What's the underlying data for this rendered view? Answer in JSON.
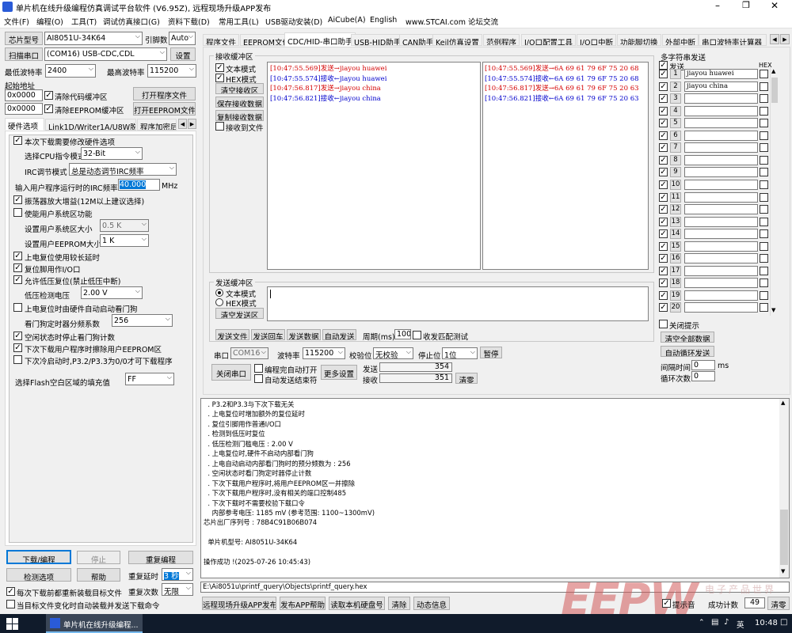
{
  "title": "单片机在线升级编程仿真调试平台软件 (V6.95Z), 远程现场升级APP发布",
  "menu": [
    "文件(F)",
    "编程(O)",
    "工具(T)",
    "调试仿真接口(G)",
    "资料下载(D)",
    "常用工具(L)",
    "USB驱动安装(D)",
    "AiCube(A)",
    "English",
    "www.STCAI.com 论坛交流"
  ],
  "left": {
    "chip_label": "芯片型号",
    "chip_value": "AI8051U-34K64",
    "pin_label": "引脚数",
    "pin_value": "Auto",
    "scan_label": "扫描串口",
    "port_value": "(COM16) USB-CDC,CDL",
    "settings_label": "设置",
    "min_baud_label": "最低波特率",
    "min_baud": "2400",
    "max_baud_label": "最高波特率",
    "max_baud": "115200",
    "start_addr_label": "起始地址",
    "addr1": "0x0000",
    "clear_code": "清除代码缓冲区",
    "open_prog": "打开程序文件",
    "addr2": "0x0000",
    "clear_eeprom": "清除EEPROM缓冲区",
    "open_eeprom": "打开EEPROM文件",
    "tabs": [
      "硬件选项",
      "Link1D/Writer1A/U8W脱机",
      "程序加密后"
    ],
    "hw_change": "本次下载需要修改硬件选项",
    "cpu_mode_label": "选择CPU指令模式",
    "cpu_mode": "32-Bit",
    "irc_mode_label": "IRC调节模式",
    "irc_mode": "总是动态调节IRC频率",
    "irc_freq_label": "输入用户程序运行时的IRC频率",
    "irc_freq": "40.000",
    "mhz": "MHz",
    "osc_gain": "振荡器放大增益(12M以上建议选择)",
    "user_sys": "使能用户系统区功能",
    "sys_size_label": "设置用户系统区大小",
    "sys_size": "0.5 K",
    "eeprom_size_label": "设置用户EEPROM大小",
    "eeprom_size": "1 K",
    "long_reset": "上电复位使用较长延时",
    "reset_io": "复位脚用作I/O口",
    "lvd": "允许低压复位(禁止低压中断)",
    "lvd_label": "低压检测电压",
    "lvd_value": "2.00 V",
    "wdt_auto": "上电复位时由硬件自动启动看门狗",
    "wdt_div_label": "看门狗定时器分频系数",
    "wdt_div": "256",
    "idle_wdt": "空闲状态时停止看门狗计数",
    "erase_eeprom": "下次下载用户程序时擦除用户EEPROM区",
    "p32": "下次冷启动时,P3.2/P3.3为0/0才可下载程序",
    "flash_fill_label": "选择Flash空白区域的填充值",
    "flash_fill": "FF",
    "download": "下载/编程",
    "stop": "停止",
    "reprog": "重复编程",
    "check": "检测选项",
    "help": "帮助",
    "delay_label": "重复延时",
    "delay": "3 秒",
    "reload": "每次下载前都重新装载目标文件",
    "count_label": "重复次数",
    "count": "无限",
    "auto_send": "当目标文件变化时自动装载并发送下载命令"
  },
  "main_tabs": [
    "程序文件",
    "EEPROM文件",
    "CDC/HID-串口助手",
    "USB-HID助手",
    "CAN助手",
    "Keil仿真设置",
    "范例程序",
    "I/O口配置工具",
    "I/O口中断",
    "功能脚切换",
    "外部中断",
    "串口波特率计算器"
  ],
  "rx": {
    "title": "接收缓冲区",
    "text_mode": "文本模式",
    "hex_mode": "HEX模式",
    "clear": "清空接收区",
    "save": "保存接收数据",
    "copy": "复制接收数据",
    "to_file": "接收到文件",
    "text_lines": [
      {
        "t": "[10:47:55.569]",
        "d": "发送→",
        "v": "jiayou huawei",
        "c": "#d40000"
      },
      {
        "t": "[10:47:55.574]",
        "d": "接收←",
        "v": "jiayou huawei",
        "c": "#0000cc"
      },
      {
        "t": "[10:47:56.817]",
        "d": "发送→",
        "v": "jiayou china",
        "c": "#d40000"
      },
      {
        "t": "[10:47:56.821]",
        "d": "接收←",
        "v": "jiayou china",
        "c": "#0000cc"
      }
    ],
    "hex_lines": [
      {
        "t": "[10:47:55.569]",
        "d": "发送→",
        "v": "6A 69 61 79 6F 75 20 68",
        "c": "#d40000"
      },
      {
        "t": "[10:47:55.574]",
        "d": "接收←",
        "v": "6A 69 61 79 6F 75 20 68",
        "c": "#0000cc"
      },
      {
        "t": "[10:47:56.817]",
        "d": "发送→",
        "v": "6A 69 61 79 6F 75 20 63",
        "c": "#d40000"
      },
      {
        "t": "[10:47:56.821]",
        "d": "接收←",
        "v": "6A 69 61 79 6F 75 20 63",
        "c": "#0000cc"
      }
    ]
  },
  "tx": {
    "title": "发送缓冲区",
    "text_mode": "文本模式",
    "hex_mode": "HEX模式",
    "clear": "清空发送区",
    "send_file": "发送文件",
    "send_enter": "发送回车",
    "send_data": "发送数据",
    "auto_send": "自动发送",
    "period_label": "周期(ms)",
    "period": "100",
    "match": "收发匹配测试"
  },
  "serial": {
    "port_label": "串口",
    "port": "COM16",
    "baud_label": "波特率",
    "baud": "115200",
    "parity_label": "校验位",
    "parity": "无校验",
    "stop_label": "停止位",
    "stop": "1位",
    "pause": "暂停",
    "close": "关闭串口",
    "auto_open": "编程完自动打开",
    "auto_send_end": "自动发送结束符",
    "more": "更多设置",
    "sent_label": "发送",
    "sent": "354",
    "recv_label": "接收",
    "recv": "351",
    "clear": "清零"
  },
  "multi": {
    "title": "多字符串发送",
    "send_label": "发送",
    "hex_label": "HEX",
    "strings": [
      "jiayou huawei",
      "jiayou china",
      "",
      "",
      "",
      "",
      "",
      "",
      "",
      "",
      "",
      "",
      "",
      "",
      "",
      "",
      "",
      "",
      "",
      ""
    ],
    "close_tip": "关闭提示",
    "clear_all": "清空全部数据",
    "loop": "自动循环发送",
    "interval_label": "间隔时间",
    "interval": "0",
    "ms": "ms",
    "loops_label": "循环次数",
    "loops": "0"
  },
  "log": [
    "  . P3.2和P3.3与下次下载无关",
    "  . 上电复位时增加额外的复位延时",
    "  . 复位引脚用作普通I/O口",
    "  . 检测到低压时复位",
    "  . 低压检测门槛电压 : 2.00 V",
    "  . 上电复位时,硬件不启动内部看门狗",
    "  . 上电自动启动内部看门狗时的预分频数为 : 256",
    "  . 空闲状态时看门狗定时器停止计数",
    "  . 下次下载用户程序时,将用户EEPROM区一并擦除",
    "  . 下次下载用户程序时,没有相关的端口控制485",
    "  . 下次下载时不需要校验下载口令",
    "    内部参考电压: 1185 mV (参考范围: 1100~1300mV)",
    "芯片出厂序列号 : 78B4C91B06B074",
    "",
    "  单片机型号: AI8051U-34K64",
    "",
    "操作成功 !(2025-07-26 10:45:43)"
  ],
  "file_path": "E:\\Ai8051u\\printf_query\\Objects\\printf_query.hex",
  "bottom": {
    "publish": "远程现场升级APP发布",
    "publish_help": "发布APP帮助",
    "read_disk": "读取本机硬盘号",
    "clear": "清除",
    "anim": "动态信息",
    "beep": "提示音",
    "success_label": "成功计数",
    "success": "49",
    "clear2": "清零"
  },
  "taskbar": {
    "app": "单片机在线升级编程...",
    "ime": "英",
    "time": "10:48"
  },
  "watermark": "EEPW",
  "watermark_sub": "电子产品世界"
}
